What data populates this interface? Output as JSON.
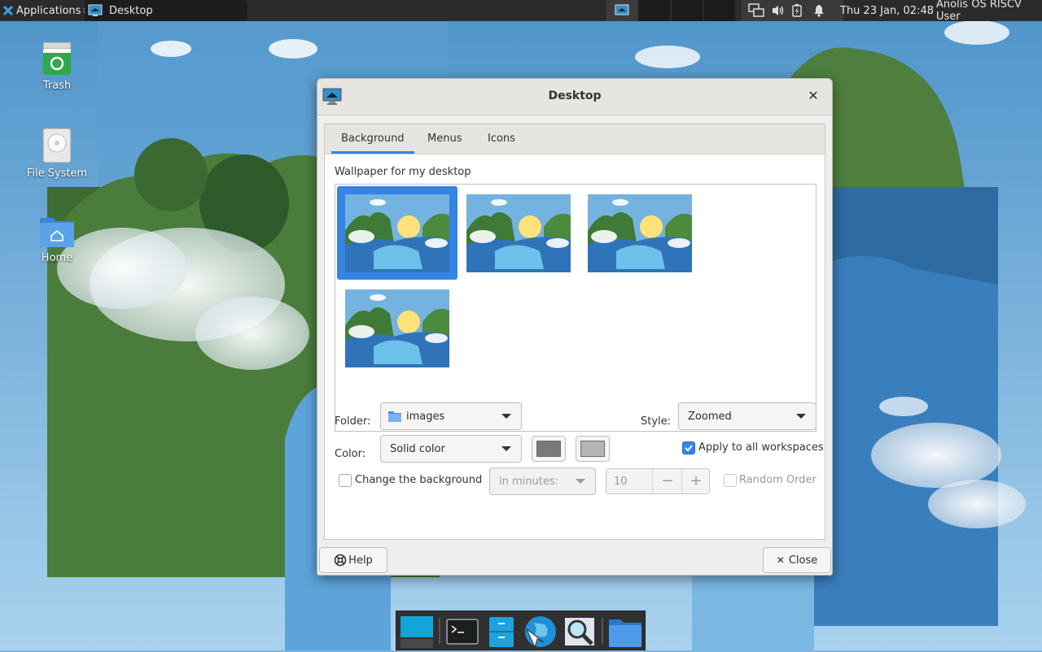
{
  "top_panel": {
    "applications_label": "Applications",
    "task_label": "Desktop",
    "clock": "Thu 23 Jan, 02:48",
    "username": "Anolis OS RISCV User"
  },
  "desktop_icons": [
    {
      "label": "Trash",
      "icon": "trash-icon"
    },
    {
      "label": "File System",
      "icon": "drive-icon"
    },
    {
      "label": "Home",
      "icon": "home-folder-icon"
    }
  ],
  "dialog": {
    "title": "Desktop",
    "tabs": [
      "Background",
      "Menus",
      "Icons"
    ],
    "active_tab": "Background",
    "wallpaper_label": "Wallpaper for my desktop",
    "wallpaper_count": 4,
    "selected_wallpaper": 0,
    "folder_label": "Folder:",
    "folder_value": "images",
    "style_label": "Style:",
    "style_value": "Zoomed",
    "color_label": "Color:",
    "color_value": "Solid color",
    "color1": "#7a7a7a",
    "color2": "#b5b5b5",
    "apply_all_label": "Apply to all workspaces",
    "apply_all_checked": true,
    "change_bg_label": "Change the background",
    "change_bg_checked": false,
    "interval_unit": "in minutes:",
    "interval_value": "10",
    "random_order_label": "Random Order",
    "random_order_checked": false,
    "help_label": "Help",
    "close_label": "Close"
  },
  "accent_color": "#3584e4",
  "dock": [
    "desktop-icon",
    "terminal-icon",
    "file-manager-icon",
    "web-browser-icon",
    "search-icon",
    "folder-icon"
  ]
}
